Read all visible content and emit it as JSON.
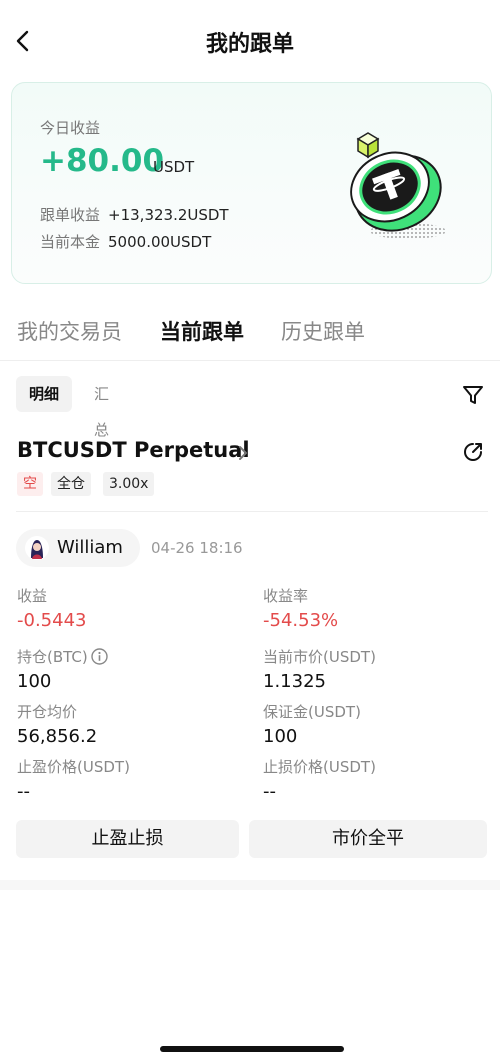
{
  "header": {
    "title": "我的跟单",
    "back_icon": "chevron-left-icon"
  },
  "summary": {
    "today_label": "今日收益",
    "today_value": "+80.00",
    "today_unit": "USDT",
    "copy_income_label": "跟单收益",
    "copy_income_value": "+13,323.2USDT",
    "principal_label": "当前本金",
    "principal_value": "5000.00USDT",
    "art_icon": "tether-coin-icon",
    "accent_color": "#25b98a"
  },
  "tabs": [
    {
      "label": "我的交易员"
    },
    {
      "label": "当前跟单",
      "active": true
    },
    {
      "label": "历史跟单"
    }
  ],
  "subtabs": [
    {
      "label": "明细",
      "active": true
    },
    {
      "label": "汇总"
    }
  ],
  "filter_icon": "filter-icon",
  "position": {
    "contract": "BTCUSDT Perpetual",
    "tags": {
      "side": "空",
      "mode": "全仓",
      "leverage": "3.00x"
    },
    "trader": {
      "name": "William",
      "avatar_icon": "avatar-icon"
    },
    "time": "04-26 18:16",
    "fields": {
      "pnl": {
        "label": "收益",
        "value": "-0.5443"
      },
      "roi": {
        "label": "收益率",
        "value": "-54.53%"
      },
      "size": {
        "label": "持仓(BTC)",
        "value": "100"
      },
      "mark_price": {
        "label": "当前市价(USDT)",
        "value": "1.1325"
      },
      "entry_price": {
        "label": "开仓均价",
        "value": "56,856.2"
      },
      "margin": {
        "label": "保证金(USDT)",
        "value": "100"
      },
      "tp_price": {
        "label": "止盈价格(USDT)",
        "value": "--"
      },
      "sl_price": {
        "label": "止损价格(USDT)",
        "value": "--"
      }
    },
    "negative_color": "#e34b4b"
  },
  "actions": {
    "tpsl_label": "止盈止损",
    "close_label": "市价全平"
  }
}
